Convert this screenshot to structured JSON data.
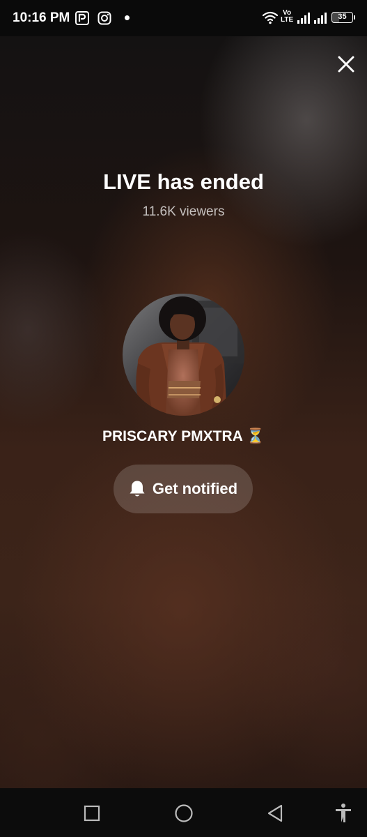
{
  "status_bar": {
    "time": "10:16 PM",
    "network_label_top": "Vo",
    "network_label_bottom": "LTE",
    "battery_level": "35",
    "battery_fraction": 0.35,
    "icons": [
      "paypal-icon",
      "instagram-icon",
      "notification-dot",
      "wifi-icon",
      "volte-icon",
      "signal-icon",
      "signal-icon-2",
      "battery-icon"
    ]
  },
  "live": {
    "title": "LIVE has ended",
    "viewers": "11.6K viewers",
    "username": "PRISCARY PMXTRA",
    "username_emoji": "⏳",
    "notify_label": "Get notified"
  },
  "controls": {
    "close_icon": "close-icon",
    "bell_icon": "bell-icon"
  },
  "nav_bar": {
    "icons": [
      "recents-icon",
      "home-icon",
      "back-icon",
      "accessibility-icon"
    ]
  },
  "colors": {
    "background_dark": "#141212",
    "background_brown": "#3c2419",
    "button_bg": "rgba(255,255,255,0.16)",
    "text": "#ffffff"
  }
}
